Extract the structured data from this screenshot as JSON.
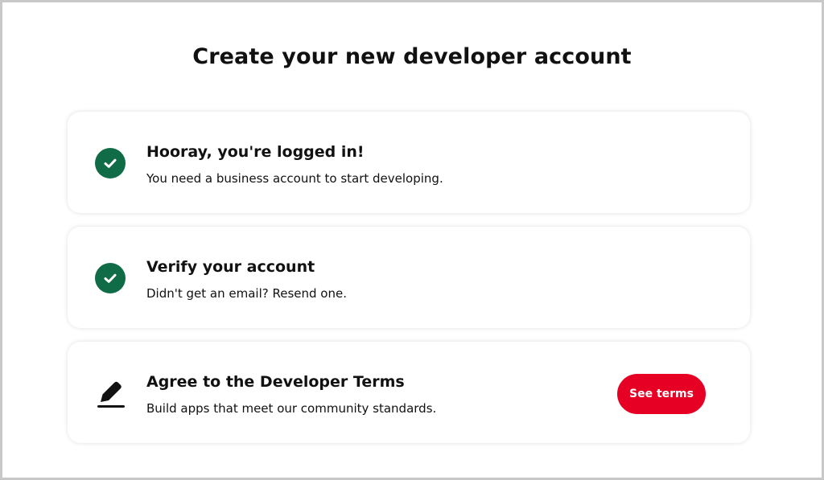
{
  "page": {
    "title": "Create your new developer account"
  },
  "steps": [
    {
      "title": "Hooray, you're logged in!",
      "description": "You need a business account to start developing.",
      "icon": "check-circle-icon",
      "status": "complete"
    },
    {
      "title": "Verify your account",
      "description": "Didn't get an email? Resend one.",
      "icon": "check-circle-icon",
      "status": "complete"
    },
    {
      "title": "Agree to the Developer Terms",
      "description": "Build apps that meet our community standards.",
      "icon": "pen-icon",
      "status": "pending",
      "button_label": "See terms"
    }
  ],
  "colors": {
    "success": "#0f6c46",
    "primary_button": "#e60023",
    "text": "#111111"
  }
}
